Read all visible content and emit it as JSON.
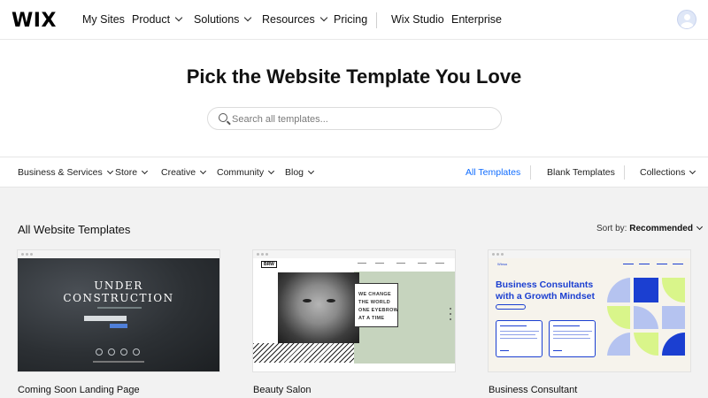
{
  "brand": {
    "logo_text": "WIX"
  },
  "topnav": {
    "items": [
      {
        "label": "My Sites",
        "has_dropdown": false
      },
      {
        "label": "Product",
        "has_dropdown": true
      },
      {
        "label": "Solutions",
        "has_dropdown": true
      },
      {
        "label": "Resources",
        "has_dropdown": true
      },
      {
        "label": "Pricing",
        "has_dropdown": false
      },
      {
        "label": "Wix Studio",
        "has_dropdown": false
      },
      {
        "label": "Enterprise",
        "has_dropdown": false
      }
    ],
    "avatar_icon": "user-avatar-icon"
  },
  "hero": {
    "title": "Pick the Website Template You Love",
    "search_placeholder": "Search all templates...",
    "search_icon": "search-icon"
  },
  "categories": {
    "left": [
      {
        "label": "Business & Services"
      },
      {
        "label": "Store"
      },
      {
        "label": "Creative"
      },
      {
        "label": "Community"
      },
      {
        "label": "Blog"
      }
    ],
    "right": [
      {
        "label": "All Templates",
        "active": true
      },
      {
        "label": "Blank Templates",
        "active": false
      },
      {
        "label": "Collections",
        "has_dropdown": true
      }
    ],
    "active_color": "#116dff"
  },
  "gallery": {
    "section_title": "All Website Templates",
    "sort_label": "Sort by:",
    "sort_value": "Recommended",
    "cards": [
      {
        "label": "Coming Soon Landing Page",
        "preview": {
          "line1": "UNDER",
          "line2": "CONSTRUCTION"
        }
      },
      {
        "label": "Beauty Salon",
        "preview": {
          "brand": "BRW",
          "lines": [
            "WE CHANGE",
            "THE WORLD",
            "ONE EYEBROW",
            "AT A TIME"
          ]
        }
      },
      {
        "label": "Business Consultant",
        "preview": {
          "brand": "Wixsa",
          "heading1": "Business Consultants",
          "heading2": "with a Growth Mindset",
          "accent": "#1b3fd1"
        }
      }
    ]
  }
}
